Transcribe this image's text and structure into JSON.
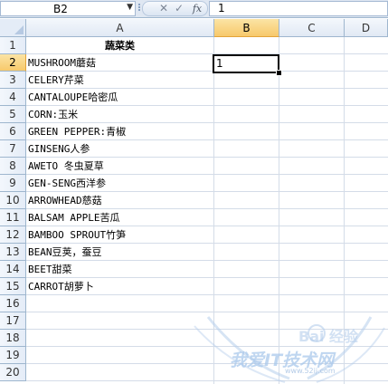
{
  "formula_bar": {
    "name_box": "B2",
    "name_box_arrow": "▼",
    "cancel_symbol": "✕",
    "enter_symbol": "✓",
    "fx_symbol": "fx",
    "formula_value": "1"
  },
  "columns": [
    "A",
    "B",
    "C",
    "D"
  ],
  "rows": [
    "1",
    "2",
    "3",
    "4",
    "5",
    "6",
    "7",
    "8",
    "9",
    "10",
    "11",
    "12",
    "13",
    "14",
    "15",
    "16",
    "17",
    "18",
    "19",
    "20"
  ],
  "column_a": [
    "蔬菜类",
    "MUSHROOM蘑菇",
    "CELERY芹菜",
    "CANTALOUPE哈密瓜",
    "CORN:玉米",
    "GREEN PEPPER:青椒",
    "GINSENG人参",
    "AWETO 冬虫夏草",
    "GEN-SENG西洋参",
    "ARROWHEAD慈菇",
    "BALSAM APPLE苦瓜",
    "BAMBOO SPROUT竹笋",
    "BEAN豆荚，蚕豆",
    "BEET甜菜",
    "CARROT胡萝卜"
  ],
  "selected_cell": {
    "ref": "B2",
    "value": "1"
  },
  "watermark": {
    "main_text": "我爱IT技术网",
    "url_text": "www.52ij.com",
    "baidu_text": "Bai 经验"
  }
}
